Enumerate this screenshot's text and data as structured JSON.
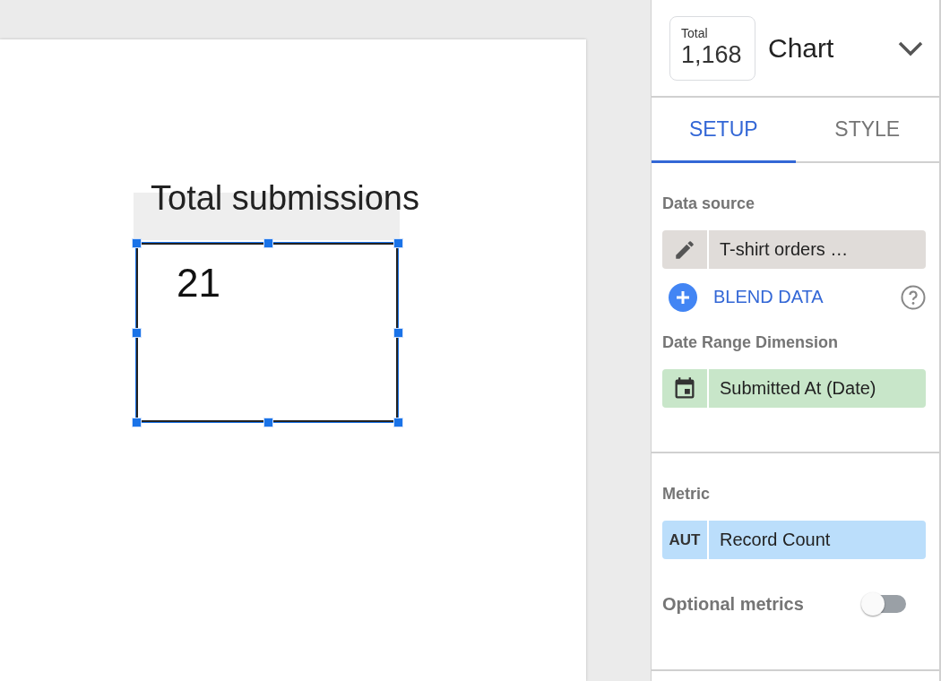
{
  "canvas": {
    "chart": {
      "title": "Total submissions",
      "value": "21",
      "selected": true
    }
  },
  "panel": {
    "total": {
      "label": "Total",
      "value": "1,168"
    },
    "title": "Chart",
    "tabs": [
      {
        "label": "SETUP",
        "selected": true
      },
      {
        "label": "STYLE",
        "selected": false
      }
    ],
    "sections": [
      {
        "items": [
          {
            "kind": "heading",
            "text": "Data source"
          },
          {
            "kind": "source",
            "text": "T-shirt orders …",
            "color": "#e0dcd9"
          },
          {
            "kind": "link",
            "text": "BLEND DATA"
          },
          {
            "kind": "heading",
            "text": "Date Range Dimension"
          },
          {
            "kind": "dimension",
            "text": "Submitted At (Date)",
            "color": "#c8e6c9"
          }
        ]
      },
      {
        "items": [
          {
            "kind": "heading",
            "text": "Metric"
          },
          {
            "kind": "metric",
            "badge": "AUT",
            "text": "Record Count",
            "color": "#bbdefb"
          },
          {
            "kind": "toggle",
            "text": "Optional metrics",
            "on": false
          }
        ]
      }
    ]
  }
}
